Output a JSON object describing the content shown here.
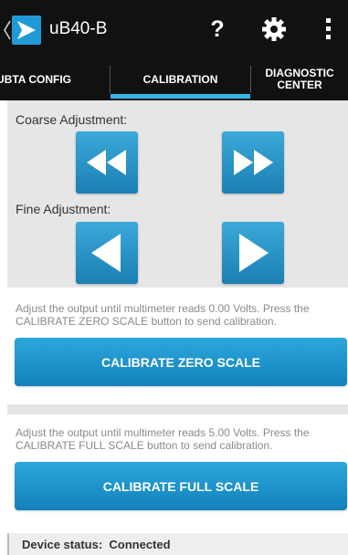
{
  "app": {
    "title": "uB40-B"
  },
  "toolbar": {
    "help_label": "?"
  },
  "tabs": [
    {
      "label": "UBTA CONFIG",
      "active": false
    },
    {
      "label": "CALIBRATION",
      "active": true
    },
    {
      "label": "DIAGNOSTIC CENTER",
      "active": false
    }
  ],
  "adjustment": {
    "coarse_label": "Coarse Adjustment:",
    "fine_label": "Fine Adjustment:"
  },
  "zero_scale": {
    "instruction": "Adjust the output until multimeter reads 0.00 Volts. Press the CALIBRATE ZERO SCALE button to send calibration.",
    "button_label": "CALIBRATE ZERO SCALE"
  },
  "full_scale": {
    "instruction": "Adjust the output until multimeter reads 5.00 Volts. Press the CALIBRATE FULL SCALE button to send calibration.",
    "button_label": "CALIBRATE FULL SCALE"
  },
  "status": {
    "text": "Device status:  Connected"
  },
  "colors": {
    "accent": "#33b5e5",
    "button": "#1a8cc6",
    "action_bar": "#111111"
  }
}
